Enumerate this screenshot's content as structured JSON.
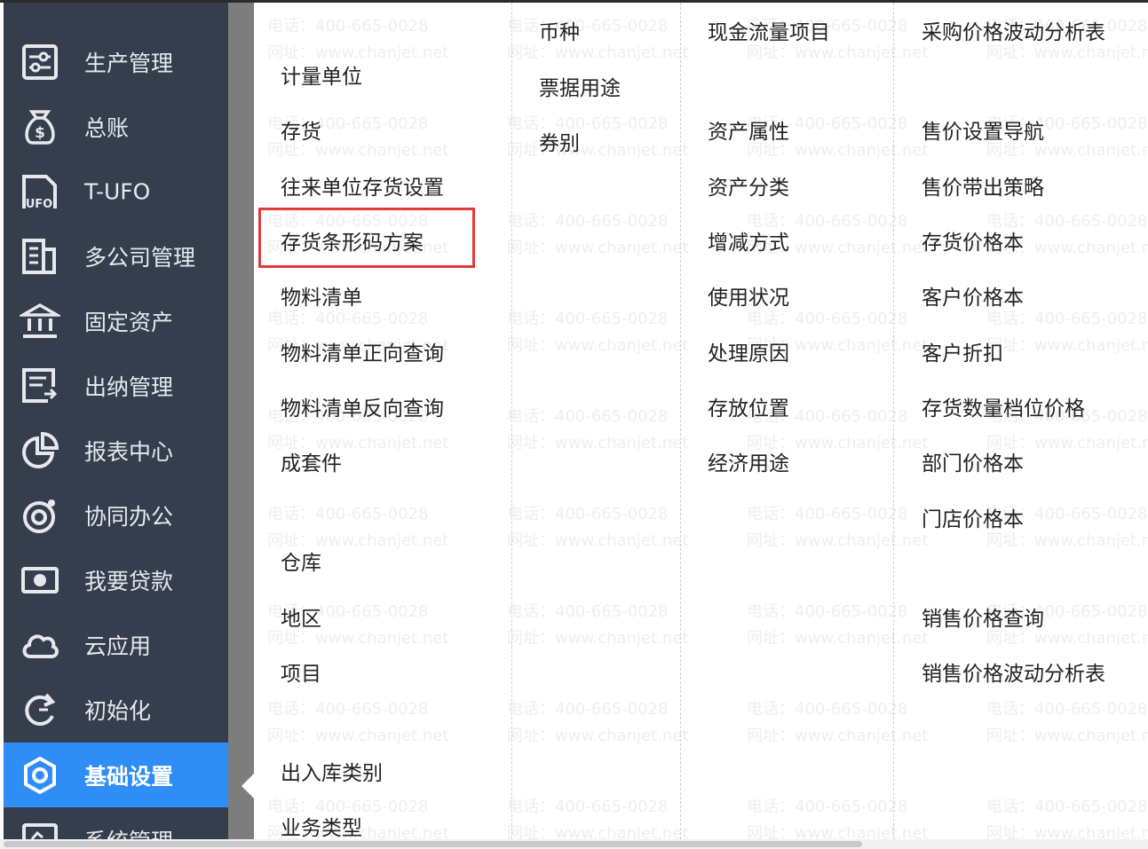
{
  "sidebar": {
    "items": [
      {
        "label": "",
        "icon": "partial-top-icon"
      },
      {
        "label": "生产管理",
        "icon": "sliders-icon"
      },
      {
        "label": "总账",
        "icon": "money-bag-icon"
      },
      {
        "label": "T-UFO",
        "icon": "ufo-icon"
      },
      {
        "label": "多公司管理",
        "icon": "building-icon"
      },
      {
        "label": "固定资产",
        "icon": "bank-icon"
      },
      {
        "label": "出纳管理",
        "icon": "cashier-icon"
      },
      {
        "label": "报表中心",
        "icon": "pie-chart-icon"
      },
      {
        "label": "协同办公",
        "icon": "collaboration-icon"
      },
      {
        "label": "我要贷款",
        "icon": "banknote-icon"
      },
      {
        "label": "云应用",
        "icon": "cloud-icon"
      },
      {
        "label": "初始化",
        "icon": "refresh-icon"
      },
      {
        "label": "基础设置",
        "icon": "settings-gear-icon",
        "active": true
      },
      {
        "label": "系统管理",
        "icon": "system-icon"
      }
    ]
  },
  "watermark": {
    "phone": "电话：400-665-0028",
    "url": "网址：www.chanjet.net"
  },
  "menu": {
    "col1": [
      "计量单位",
      "存货",
      "往来单位存货设置",
      "存货条形码方案",
      "物料清单",
      "物料清单正向查询",
      "物料清单反向查询",
      "成套件",
      "仓库",
      "地区",
      "项目",
      "出入库类别",
      "业务类型"
    ],
    "col2": [
      "币种",
      "票据用途",
      "券别"
    ],
    "col3": [
      "现金流量项目",
      "资产属性",
      "资产分类",
      "增减方式",
      "使用状况",
      "处理原因",
      "存放位置",
      "经济用途"
    ],
    "col4": [
      "采购价格波动分析表",
      "售价设置导航",
      "售价带出策略",
      "存货价格本",
      "客户价格本",
      "客户折扣",
      "存货数量档位价格",
      "部门价格本",
      "门店价格本",
      "销售价格查询",
      "销售价格波动分析表"
    ]
  },
  "colors": {
    "sidebar_bg": "#343e4d",
    "active_bg": "#2f8ef5",
    "highlight_border": "#e03a3a"
  }
}
